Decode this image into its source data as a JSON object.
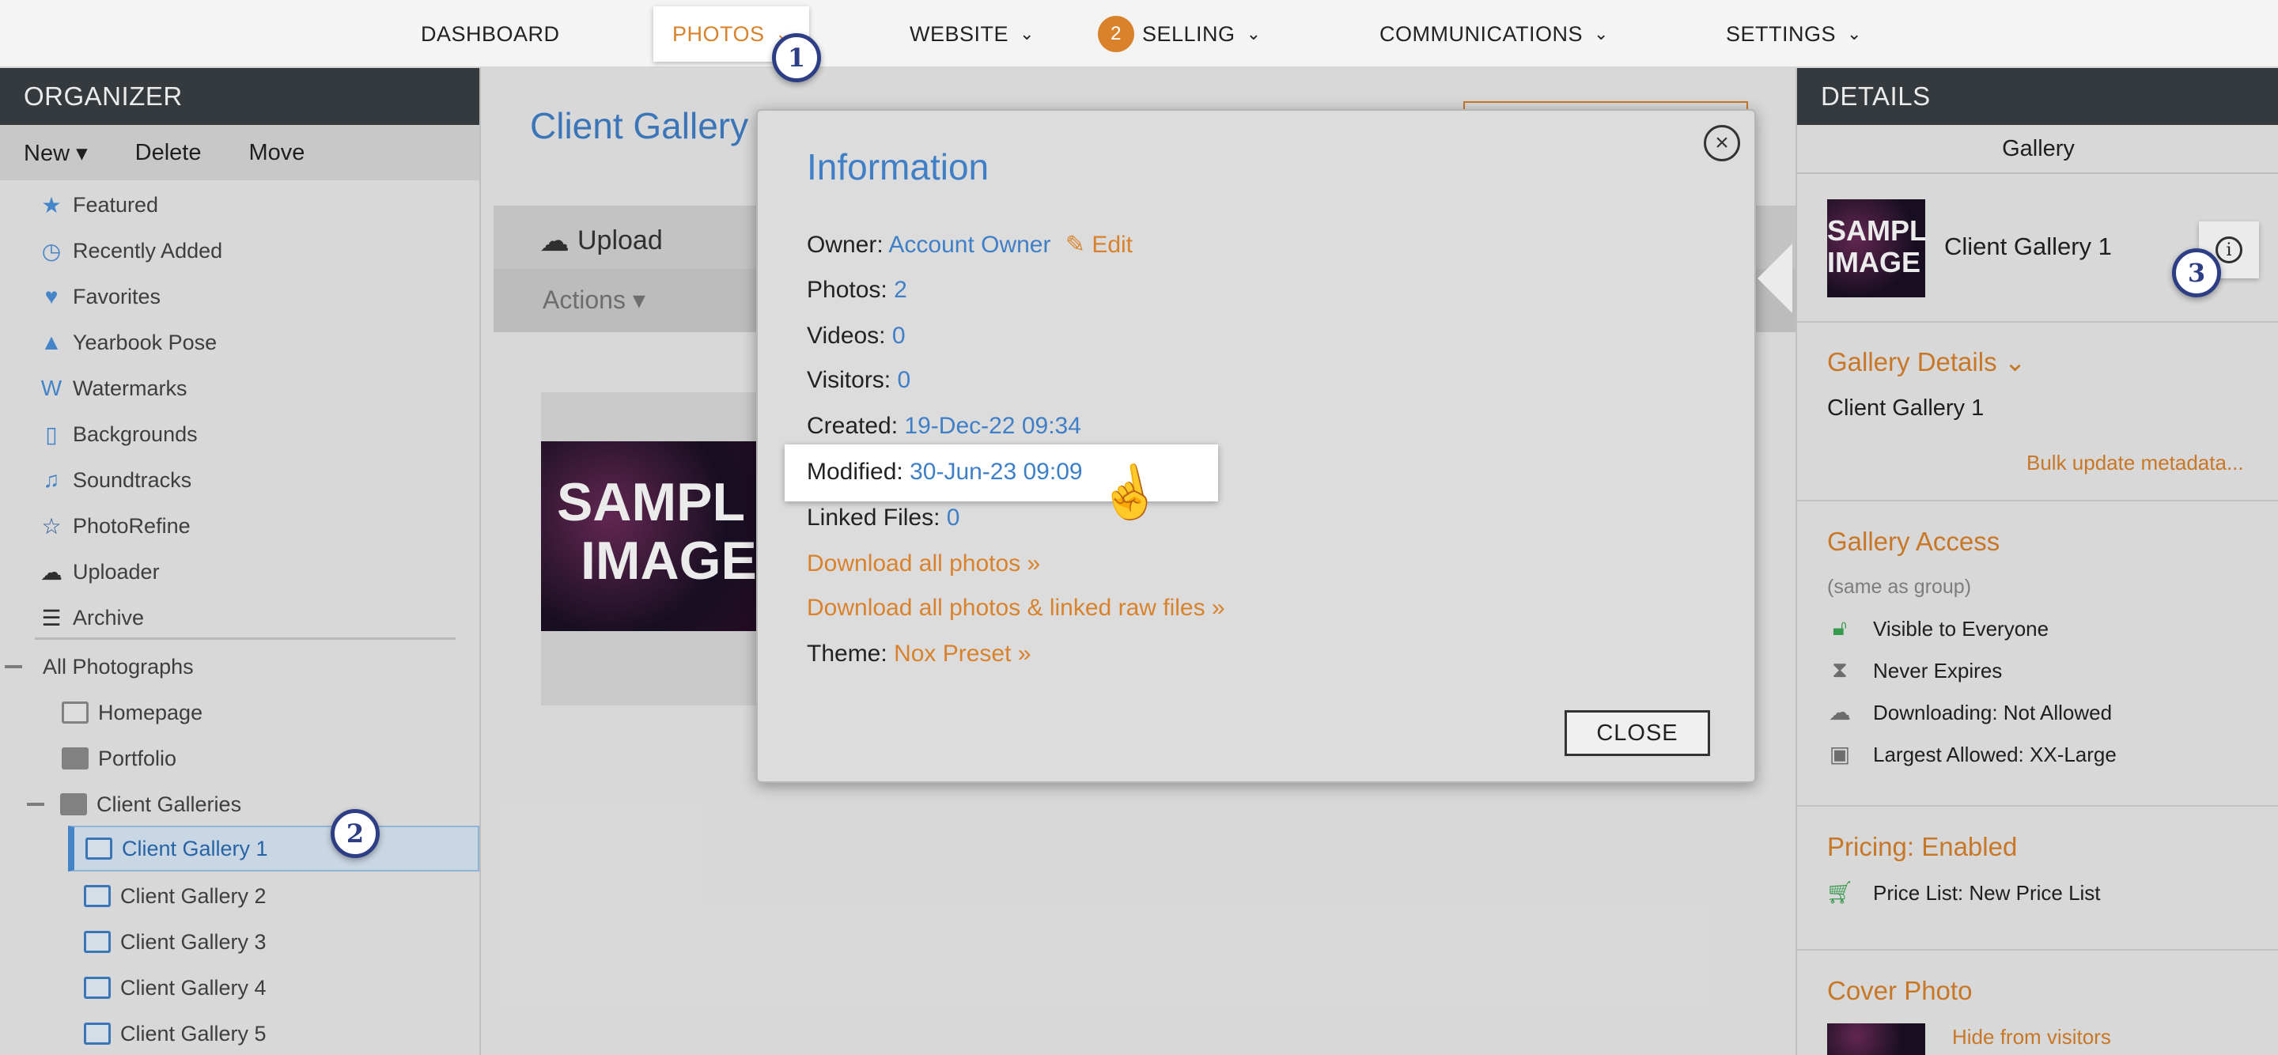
{
  "nav": {
    "dashboard": "DASHBOARD",
    "photos": "PHOTOS",
    "website": "WEBSITE",
    "selling_count": "2",
    "selling": "SELLING",
    "communications": "COMMUNICATIONS",
    "settings": "SETTINGS",
    "chevron": "⌄"
  },
  "callouts": {
    "one": "1",
    "two": "2",
    "three": "3"
  },
  "organizer": {
    "title": "ORGANIZER",
    "toolbar": {
      "new": "New ▾",
      "delete": "Delete",
      "move": "Move"
    },
    "items": [
      {
        "label": "Featured",
        "icon": "star-icon"
      },
      {
        "label": "Recently Added",
        "icon": "clock-icon"
      },
      {
        "label": "Favorites",
        "icon": "heart-icon"
      },
      {
        "label": "Yearbook Pose",
        "icon": "graduation-cap-icon"
      },
      {
        "label": "Watermarks",
        "icon": "watermark-icon"
      },
      {
        "label": "Backgrounds",
        "icon": "background-icon"
      },
      {
        "label": "Soundtracks",
        "icon": "music-icon"
      },
      {
        "label": "PhotoRefine",
        "icon": "star-outline-icon"
      },
      {
        "label": "Uploader",
        "icon": "cloud-upload-icon"
      },
      {
        "label": "Archive",
        "icon": "archive-icon"
      }
    ],
    "tree": {
      "all": "All Photographs",
      "homepage": "Homepage",
      "portfolio": "Portfolio",
      "client_galleries": "Client Galleries",
      "galleries": [
        "Client Gallery 1",
        "Client Gallery 2",
        "Client Gallery 3",
        "Client Gallery 4",
        "Client Gallery 5"
      ]
    }
  },
  "center": {
    "title": "Client Gallery",
    "upload": "Upload",
    "actions": "Actions ▾",
    "sample_line1": "SAMPL",
    "sample_line2": "IMAGE"
  },
  "modal": {
    "title": "Information",
    "owner_label": "Owner:",
    "owner_value": "Account Owner",
    "edit": "Edit",
    "photos_label": "Photos:",
    "photos_value": "2",
    "videos_label": "Videos:",
    "videos_value": "0",
    "visitors_label": "Visitors:",
    "visitors_value": "0",
    "created_label": "Created:",
    "created_value": "19-Dec-22 09:34",
    "modified_label": "Modified:",
    "modified_value": "30-Jun-23 09:09",
    "linked_label": "Linked Files:",
    "linked_value": "0",
    "download_all": "Download all photos »",
    "download_raw": "Download all photos & linked raw files »",
    "theme_label": "Theme:",
    "theme_value": "Nox Preset »",
    "close": "CLOSE",
    "close_x": "×"
  },
  "details": {
    "title": "DETAILS",
    "tab": "Gallery",
    "gallery_name": "Client Gallery 1",
    "thumb_line1": "SAMPL",
    "thumb_line2": "IMAGE",
    "gallery_details_heading": "Gallery Details ⌄",
    "gallery_details_name": "Client Gallery 1",
    "bulk_update": "Bulk update metadata...",
    "access_heading": "Gallery Access",
    "access_note": "(same as group)",
    "visible": "Visible to Everyone",
    "expires": "Never Expires",
    "downloading": "Downloading: Not Allowed",
    "largest": "Largest Allowed: XX-Large",
    "pricing_heading": "Pricing: Enabled",
    "price_list": "Price List: New Price List",
    "cover_heading": "Cover Photo",
    "hide_visitors": "Hide from visitors"
  },
  "colors": {
    "accent_orange": "#d9822b",
    "link_blue": "#3f7fc8",
    "header_dark": "#3a3f45",
    "callout_navy": "#2e3e85"
  }
}
